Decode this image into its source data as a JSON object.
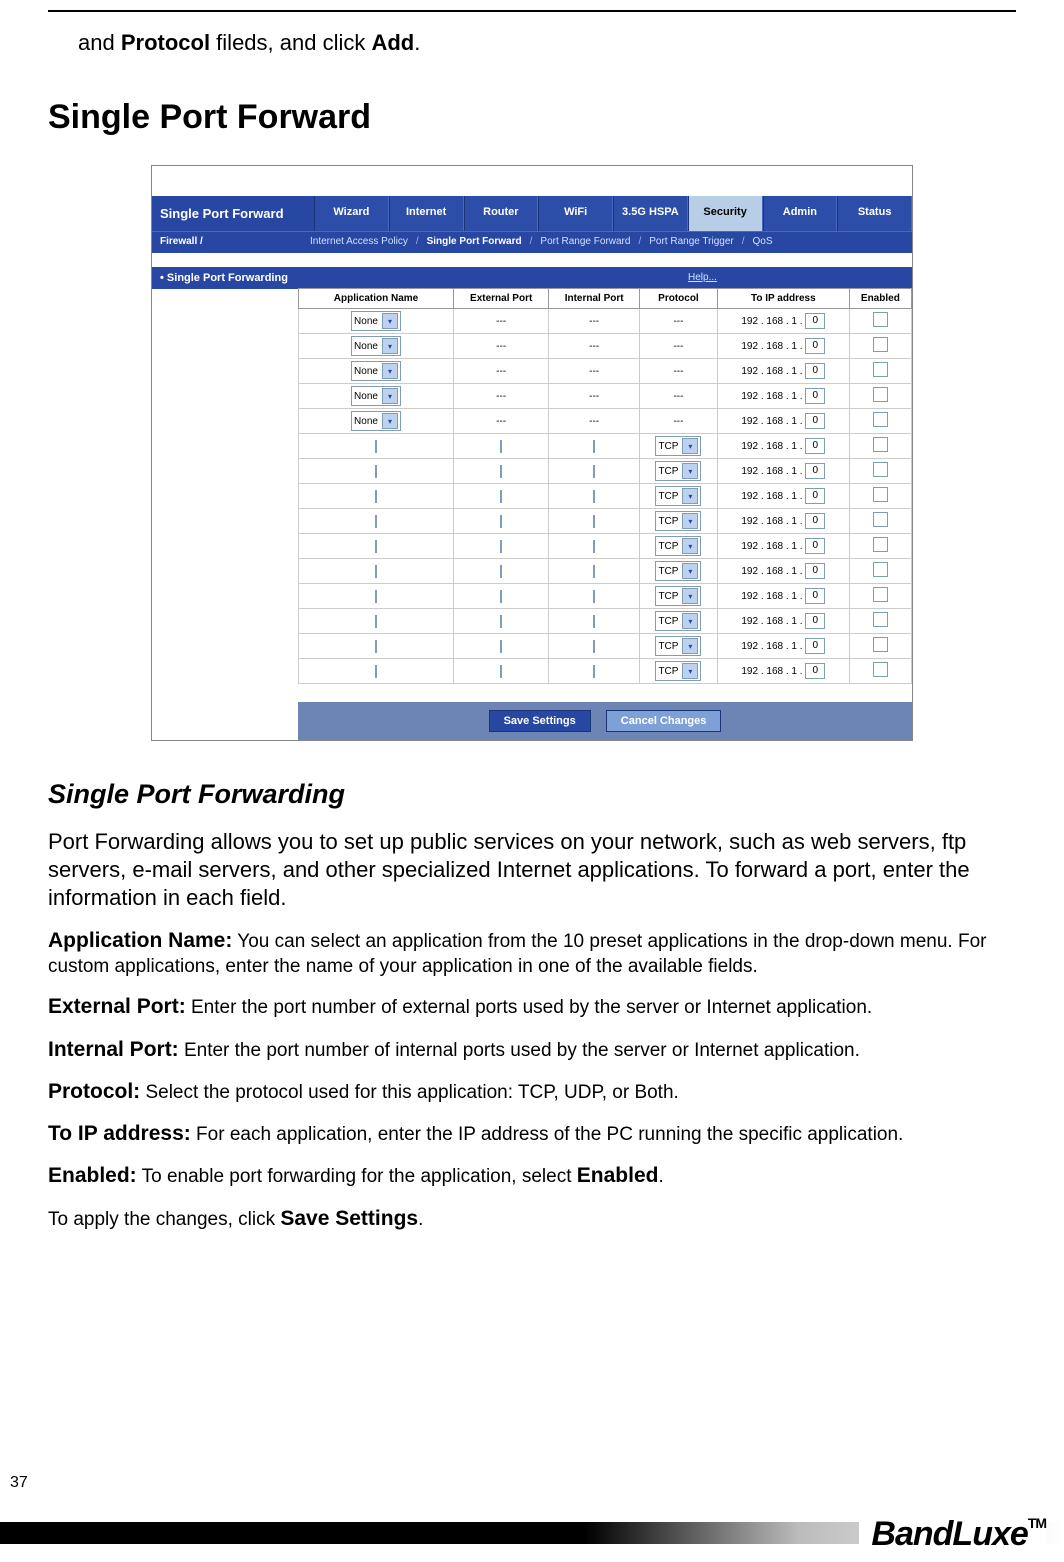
{
  "intro": {
    "prefix": "and ",
    "bold1": "Protocol",
    "mid": " fileds, and click ",
    "bold2": "Add",
    "suffix": "."
  },
  "section_title": "Single Port Forward",
  "screenshot": {
    "panel_title": "Single Port Forward",
    "tabs": [
      "Wizard",
      "Internet",
      "Router",
      "WiFi",
      "3.5G HSPA",
      "Security",
      "Admin",
      "Status"
    ],
    "active_tab": "Security",
    "subnav_left": "Firewall /",
    "subnav_items": [
      "Internet Access Policy",
      "Single Port Forward",
      "Port Range Forward",
      "Port Range Trigger",
      "QoS"
    ],
    "subnav_active": "Single Port Forward",
    "side_heading": "Single Port Forwarding",
    "help_label": "Help...",
    "columns": [
      "Application Name",
      "External Port",
      "Internal Port",
      "Protocol",
      "To IP address",
      "Enabled"
    ],
    "preset_select": "None",
    "dash": "---",
    "proto_select": "TCP",
    "ip_prefix": "192 . 168 . 1 .",
    "ip_last": "0",
    "save_btn": "Save Settings",
    "cancel_btn": "Cancel Changes",
    "preset_rows": 5,
    "custom_rows": 10
  },
  "subheading": "Single Port Forwarding",
  "body_para": "Port Forwarding allows you to set up public services on your network, such as web servers, ftp servers, e-mail servers, and other specialized Internet applications. To forward a port, enter the information in each field.",
  "defs": {
    "app_name_lead": "Application Name:",
    "app_name_text": " You can select an application from the 10 preset applications in the drop-down menu. For custom applications, enter the name of your application in one of the available fields.",
    "ext_port_lead": "External Port:",
    "ext_port_text": " Enter the port number of external ports used by the server or Internet application.",
    "int_port_lead": "Internal Port:",
    "int_port_text": " Enter the port number of internal ports used by the server or Internet application.",
    "proto_lead": "Protocol:",
    "proto_text": " Select the protocol used for this application: TCP, UDP, or Both.",
    "toip_lead": "To IP address:",
    "toip_text": " For each application, enter the IP address of the PC running the specific application.",
    "enabled_lead": "Enabled:",
    "enabled_text_a": " To enable port forwarding for the application, select ",
    "enabled_strong": "Enabled",
    "enabled_text_b": ".",
    "apply_a": "To apply the changes, click ",
    "apply_strong": "Save Settings",
    "apply_b": "."
  },
  "page_number": "37",
  "footer_logo": "BandLuxe",
  "footer_tm": "TM"
}
